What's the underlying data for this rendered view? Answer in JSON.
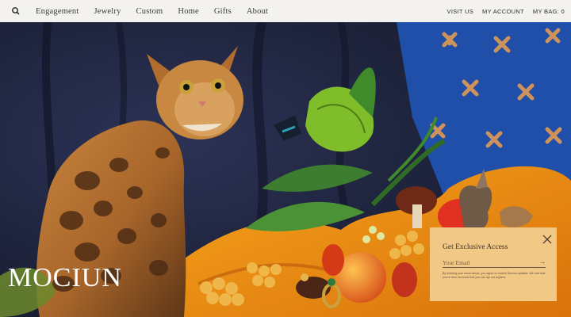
{
  "nav": {
    "search_icon": "search-icon",
    "left_links": [
      "Engagement",
      "Jewelry",
      "Custom",
      "Home",
      "Gifts",
      "About"
    ],
    "right_links": [
      "VISIT US",
      "MY ACCOUNT",
      "MY BAG: 0"
    ]
  },
  "hero": {
    "brand": "MOCIUN"
  },
  "popup": {
    "title": "Get Exclusive Access",
    "email_placeholder": "Your Email",
    "submit_glyph": "→",
    "close_icon": "close-icon",
    "legal": "By entering your email above, you agree to receive Mociun updates. We love that you're here but know that you can opt out anytime."
  },
  "colors": {
    "nav_bg": "#f4f2ef",
    "popup_bg": "#f2c887",
    "backdrop": "#1b2038",
    "blue_wall": "#1f4fa8"
  }
}
